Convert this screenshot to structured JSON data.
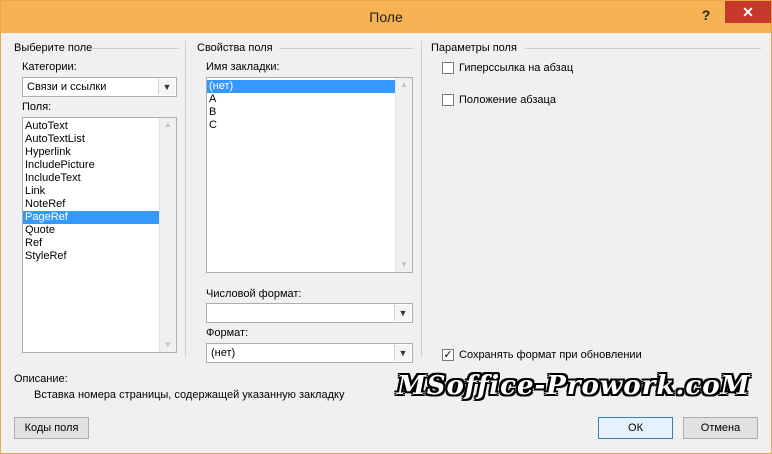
{
  "window": {
    "title": "Поле",
    "help_label": "?",
    "close_label": "✕"
  },
  "left": {
    "section_title": "Выберите поле",
    "categories_label": "Категории:",
    "categories_value": "Связи и ссылки",
    "fields_label": "Поля:",
    "fields": [
      "AutoText",
      "AutoTextList",
      "Hyperlink",
      "IncludePicture",
      "IncludeText",
      "Link",
      "NoteRef",
      "PageRef",
      "Quote",
      "Ref",
      "StyleRef"
    ],
    "selected_field": "PageRef"
  },
  "middle": {
    "section_title": "Свойства поля",
    "bookmark_label": "Имя закладки:",
    "bookmarks": [
      "(нет)",
      "A",
      "B",
      "C"
    ],
    "selected_bookmark": "(нет)",
    "number_format_label": "Числовой формат:",
    "number_format_value": "",
    "format_label": "Формат:",
    "format_value": "(нет)"
  },
  "right": {
    "section_title": "Параметры поля",
    "hyperlink_option": "Гиперссылка на абзац",
    "hyperlink_checked": false,
    "position_option": "Положение абзаца",
    "position_checked": false,
    "preserve_option": "Сохранять формат при обновлении",
    "preserve_checked": true
  },
  "description": {
    "label": "Описание:",
    "text": "Вставка номера страницы, содержащей указанную закладку"
  },
  "buttons": {
    "field_codes": "Коды поля",
    "ok": "ОК",
    "cancel": "Отмена"
  },
  "watermark": "MSoffice-Prowork.coM",
  "icons": {
    "check": "check-icon",
    "dropdown": "chevron-down-icon"
  }
}
